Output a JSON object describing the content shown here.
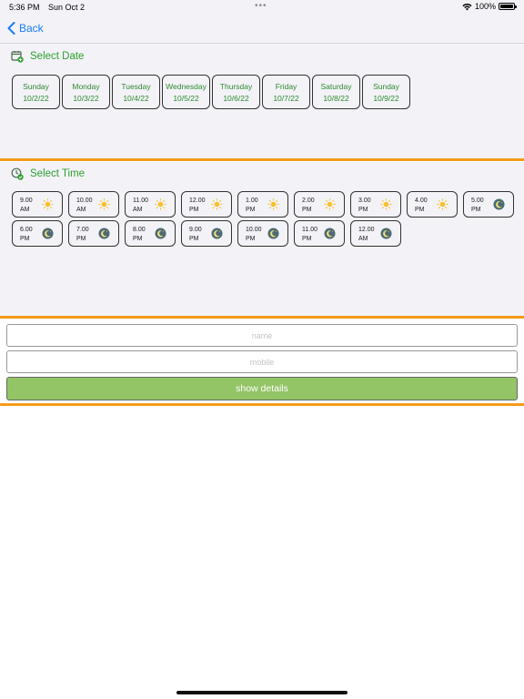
{
  "status_bar": {
    "time": "5:36 PM",
    "date": "Sun Oct 2",
    "battery": "100%",
    "dots": "•••"
  },
  "nav": {
    "back_label": "Back"
  },
  "date_section": {
    "title": "Select Date",
    "dates": [
      {
        "day": "Sunday",
        "date": "10/2/22"
      },
      {
        "day": "Monday",
        "date": "10/3/22"
      },
      {
        "day": "Tuesday",
        "date": "10/4/22"
      },
      {
        "day": "Wednesday",
        "date": "10/5/22"
      },
      {
        "day": "Thursday",
        "date": "10/6/22"
      },
      {
        "day": "Friday",
        "date": "10/7/22"
      },
      {
        "day": "Saturday",
        "date": "10/8/22"
      },
      {
        "day": "Sunday",
        "date": "10/9/22"
      }
    ]
  },
  "time_section": {
    "title": "Select Time",
    "slots": [
      {
        "time": "9.00",
        "period": "AM",
        "icon": "sun-icon"
      },
      {
        "time": "10.00",
        "period": "AM",
        "icon": "sun-icon"
      },
      {
        "time": "11.00",
        "period": "AM",
        "icon": "sun-icon"
      },
      {
        "time": "12.00",
        "period": "PM",
        "icon": "sun-icon"
      },
      {
        "time": "1.00",
        "period": "PM",
        "icon": "sun-icon"
      },
      {
        "time": "2.00",
        "period": "PM",
        "icon": "sun-icon"
      },
      {
        "time": "3.00",
        "period": "PM",
        "icon": "sun-icon"
      },
      {
        "time": "4.00",
        "period": "PM",
        "icon": "sun-icon"
      },
      {
        "time": "5.00",
        "period": "PM",
        "icon": "moon-icon"
      },
      {
        "time": "6.00",
        "period": "PM",
        "icon": "moon-icon"
      },
      {
        "time": "7.00",
        "period": "PM",
        "icon": "moon-icon"
      },
      {
        "time": "8.00",
        "period": "PM",
        "icon": "moon-icon"
      },
      {
        "time": "9.00",
        "period": "PM",
        "icon": "moon-icon"
      },
      {
        "time": "10.00",
        "period": "PM",
        "icon": "moon-icon"
      },
      {
        "time": "11.00",
        "period": "PM",
        "icon": "moon-icon"
      },
      {
        "time": "12.00",
        "period": "AM",
        "icon": "moon-icon"
      }
    ]
  },
  "form": {
    "name_placeholder": "name",
    "mobile_placeholder": "mobile",
    "submit_label": "show details"
  },
  "colors": {
    "accent_green": "#2ea02e",
    "divider_orange": "#f59a1a",
    "button_green": "#93c466",
    "link_blue": "#1a7cf5"
  }
}
